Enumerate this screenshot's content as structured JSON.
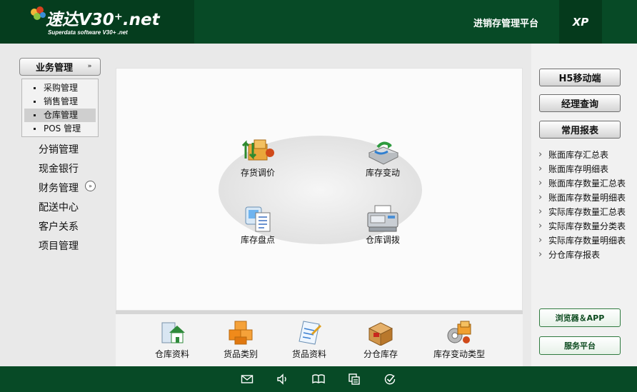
{
  "header": {
    "logo_text": "速达V30⁺.net",
    "logo_subtext": "Superdata software V30+ .net",
    "platform_title": "进销存管理平台",
    "edition": "XP"
  },
  "left_nav": {
    "biz_button": "业务管理",
    "sub_items": [
      "采购管理",
      "销售管理",
      "仓库管理",
      "POS 管理"
    ],
    "items": [
      "分销管理",
      "现金银行",
      "财务管理",
      "配送中心",
      "客户关系",
      "项目管理"
    ]
  },
  "main": {
    "functions": [
      "存货调价",
      "库存变动",
      "库存盘点",
      "仓库调拨"
    ]
  },
  "toolbar": {
    "items": [
      "仓库资料",
      "货品类别",
      "货品资料",
      "分仓库存",
      "库存变动类型"
    ]
  },
  "right_panel": {
    "h5_button": "H5移动端",
    "manager_button": "经理查询",
    "reports_button": "常用报表",
    "reports": [
      "账面库存汇总表",
      "账面库存明细表",
      "账面库存数量汇总表",
      "账面库存数量明细表",
      "实际库存数量汇总表",
      "实际库存数量分类表",
      "实际库存数量明细表",
      "分仓库存报表"
    ],
    "browser_button": "浏览器＆APP",
    "service_button": "服务平台"
  },
  "colors": {
    "header_bg": "#074a26",
    "accent_green": "#2f7a3f"
  }
}
